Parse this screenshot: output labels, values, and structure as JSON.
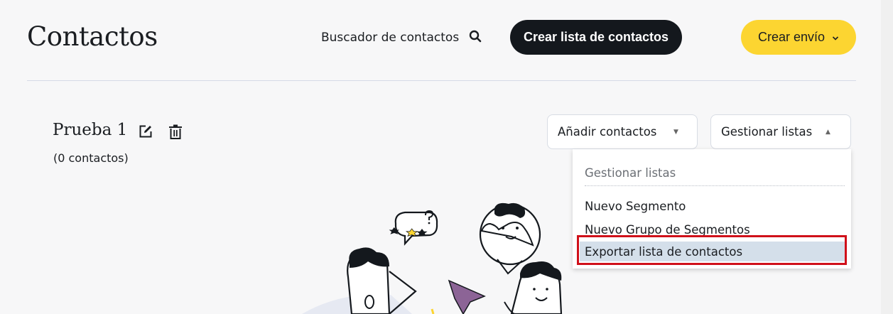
{
  "header": {
    "title": "Contactos",
    "search_label": "Buscador de contactos",
    "create_list_label": "Crear lista de contactos",
    "create_send_label": "Crear envío"
  },
  "list": {
    "name": "Prueba 1",
    "count": "(0 contactos)"
  },
  "actions": {
    "add_contacts_label": "Añadir contactos",
    "manage_lists_label": "Gestionar listas"
  },
  "menu": {
    "header": "Gestionar listas",
    "items": [
      {
        "label": "Nuevo Segmento"
      },
      {
        "label": "Nuevo Grupo de Segmentos"
      },
      {
        "label": "Exportar lista de contactos",
        "active": true
      }
    ]
  },
  "colors": {
    "dark_button": "#14181d",
    "accent_yellow": "#fcd531",
    "highlight_red": "#d0101a",
    "menu_active_bg": "#d4dfea"
  },
  "icons": [
    "search-icon",
    "chevron-down-icon",
    "edit-icon",
    "trash-icon",
    "caret-down-icon",
    "caret-up-icon"
  ]
}
